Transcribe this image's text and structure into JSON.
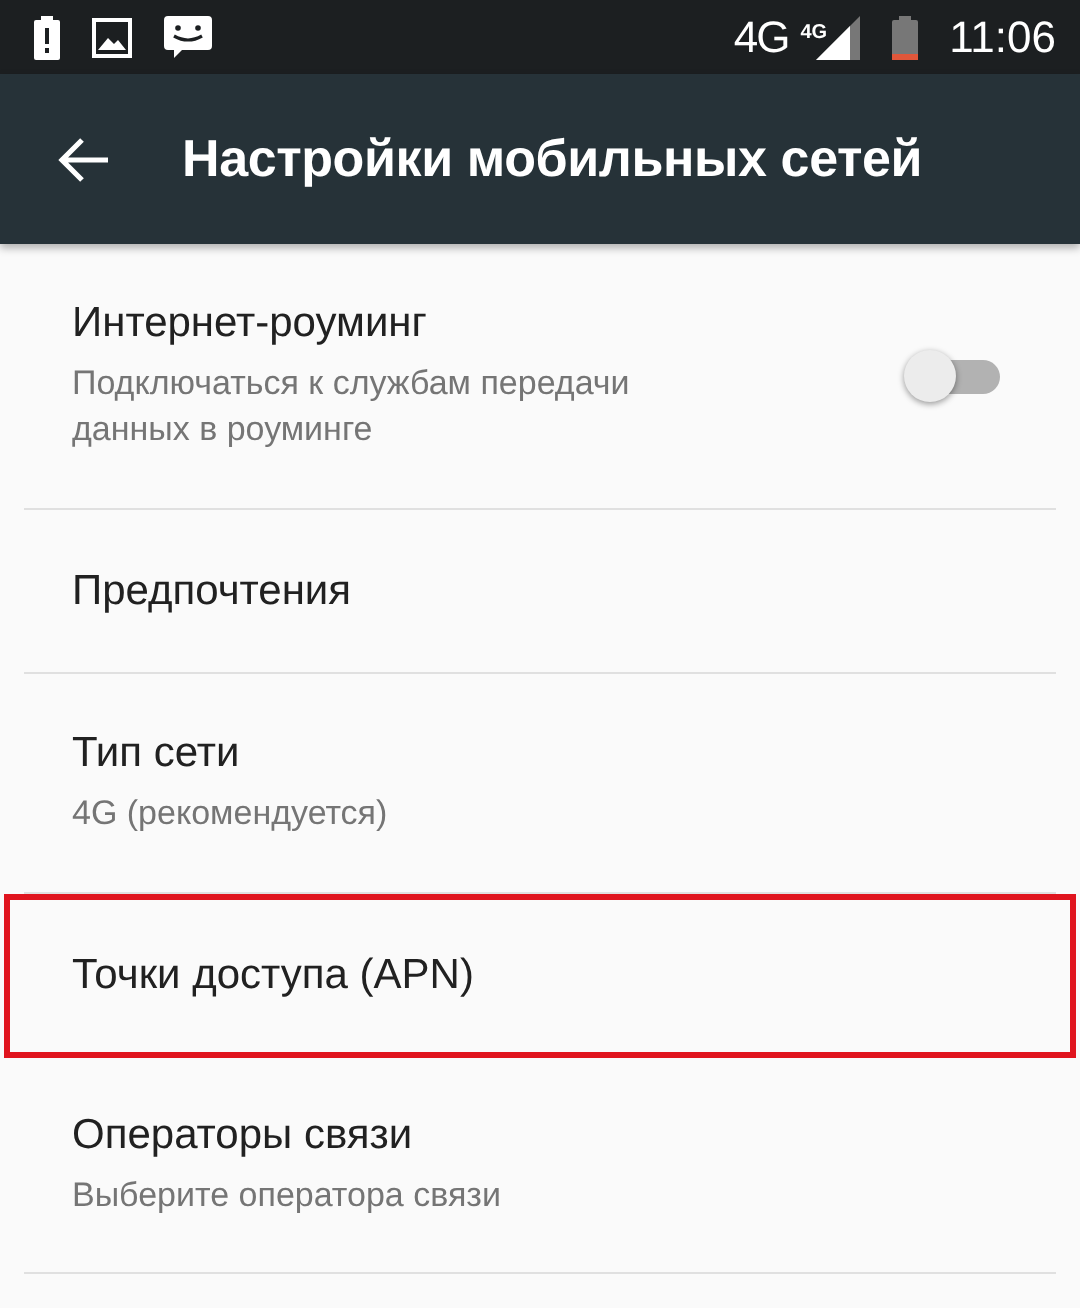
{
  "status_bar": {
    "network": "4G",
    "network_badge": "4G",
    "time": "11:06"
  },
  "app_bar": {
    "title": "Настройки мобильных сетей"
  },
  "items": [
    {
      "kind": "toggle",
      "title": "Интернет-роуминг",
      "summary": "Подключаться к службам передачи данных в роуминге",
      "on": false,
      "highlighted": false
    },
    {
      "kind": "plain",
      "title": "Предпочтения",
      "highlighted": false
    },
    {
      "kind": "plain",
      "title": "Тип сети",
      "summary": "4G (рекомендуется)",
      "highlighted": false
    },
    {
      "kind": "plain",
      "title": "Точки доступа (APN)",
      "highlighted": true
    },
    {
      "kind": "plain",
      "title": "Операторы связи",
      "summary": "Выберите оператора связи",
      "highlighted": false
    }
  ]
}
